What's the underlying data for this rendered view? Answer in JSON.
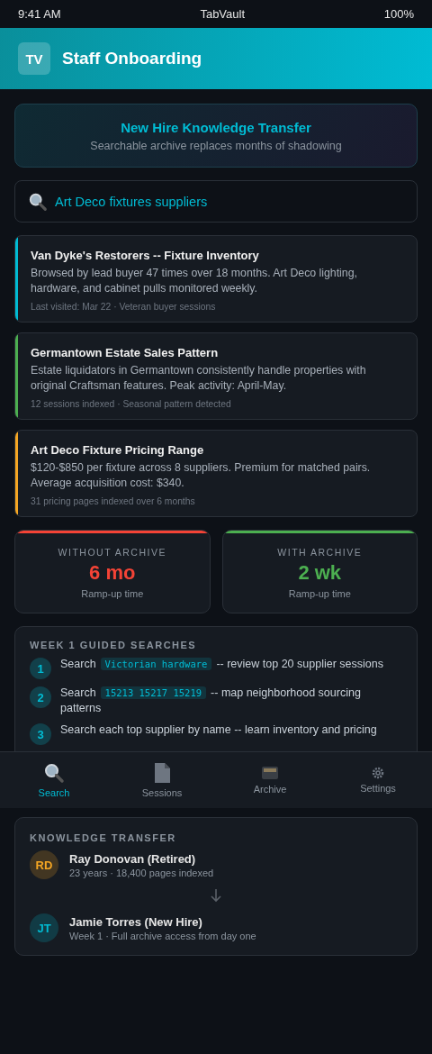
{
  "status_bar": {
    "time": "9:41 AM",
    "title": "TabVault",
    "battery": "100%"
  },
  "header": {
    "logo": "TV",
    "title": "Staff Onboarding"
  },
  "hero": {
    "title": "New Hire Knowledge Transfer",
    "subtitle": "Searchable archive replaces months of shadowing"
  },
  "search": {
    "value": "Art Deco fixtures suppliers"
  },
  "results": [
    {
      "title": "Van Dyke's Restorers -- Fixture Inventory",
      "description": "Browsed by lead buyer 47 times over 18 months. Art Deco lighting, hardware, and cabinet pulls monitored weekly.",
      "meta": "Last visited: Mar 22 · Veteran buyer sessions",
      "color": "#00bcd4"
    },
    {
      "title": "Germantown Estate Sales Pattern",
      "description": "Estate liquidators in Germantown consistently handle properties with original Craftsman features. Peak activity: April-May.",
      "meta": "12 sessions indexed · Seasonal pattern detected",
      "color": "#4caf50"
    },
    {
      "title": "Art Deco Fixture Pricing Range",
      "description": "$120-$850 per fixture across 8 suppliers. Premium for matched pairs. Average acquisition cost: $340.",
      "meta": "31 pricing pages indexed over 6 months",
      "color": "#f5a623"
    }
  ],
  "comparison": [
    {
      "label": "WITHOUT ARCHIVE",
      "value": "6 mo",
      "caption": "Ramp-up time",
      "color": "#f44336"
    },
    {
      "label": "WITH ARCHIVE",
      "value": "2 wk",
      "caption": "Ramp-up time",
      "color": "#4caf50"
    }
  ],
  "guided": {
    "title": "WEEK 1 GUIDED SEARCHES",
    "steps": [
      {
        "number": "1",
        "parts": [
          {
            "kind": "text",
            "text": "Search"
          },
          {
            "kind": "code",
            "text": "Victorian hardware"
          },
          {
            "kind": "text",
            "text": "-- review top 20 supplier sessions"
          }
        ]
      },
      {
        "number": "2",
        "parts": [
          {
            "kind": "text",
            "text": "Search"
          },
          {
            "kind": "code",
            "text": "15213 15217 15219"
          },
          {
            "kind": "text",
            "text": "-- map neighborhood sourcing patterns"
          }
        ]
      },
      {
        "number": "3",
        "parts": [
          {
            "kind": "text",
            "text": "Search each top supplier by name -- learn inventory and pricing"
          }
        ]
      }
    ]
  },
  "tab_bar": [
    {
      "label": "Search",
      "kind": "search",
      "selected": true
    },
    {
      "label": "Sessions",
      "kind": "sessions",
      "selected": false
    },
    {
      "label": "Archive",
      "kind": "archive",
      "selected": false
    },
    {
      "label": "Settings",
      "kind": "settings",
      "selected": false
    }
  ],
  "transfer": {
    "title": "KNOWLEDGE TRANSFER",
    "people": [
      {
        "initials": "RD",
        "name": "Ray Donovan (Retired)",
        "detail": "23 years · 18,400 pages indexed",
        "color": "#f5a623"
      },
      {
        "initials": "JT",
        "name": "Jamie Torres (New Hire)",
        "detail": "Week 1 · Full archive access from day one",
        "color": "#00bcd4"
      }
    ]
  }
}
